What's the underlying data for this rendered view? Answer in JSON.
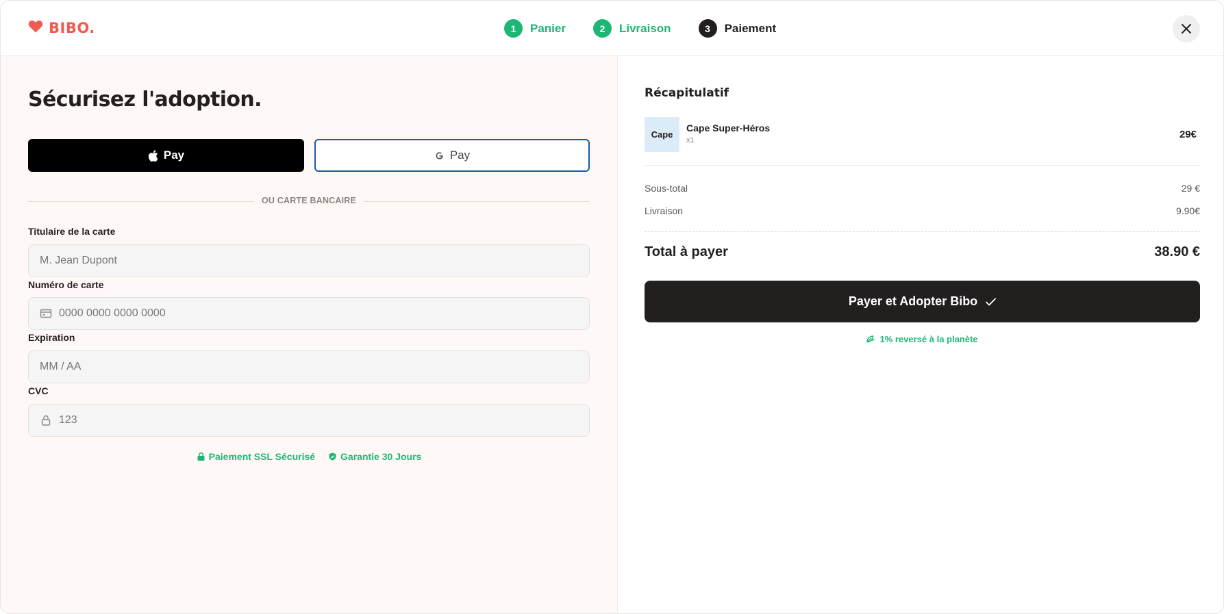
{
  "colors": {
    "brand": "#ef5a52",
    "success": "#1db674",
    "dark": "#231f1f",
    "left_panel_bg": "#fff8f6",
    "google_border": "#1a56a8"
  },
  "header": {
    "logo_icon": "heart-icon",
    "logo_text": "BIBO.",
    "steps": [
      {
        "number": "1",
        "label": "Panier",
        "state": "done"
      },
      {
        "number": "2",
        "label": "Livraison",
        "state": "done"
      },
      {
        "number": "3",
        "label": "Paiement",
        "state": "active"
      }
    ],
    "close_icon": "close-icon"
  },
  "payment": {
    "title": "Sécurisez l'adoption.",
    "apple_pay_label": "Pay",
    "google_pay_label": "Pay",
    "divider_text": "OU CARTE BANCAIRE",
    "fields": {
      "holder": {
        "label": "Titulaire de la carte",
        "placeholder": "M. Jean Dupont",
        "value": ""
      },
      "number": {
        "label": "Numéro de carte",
        "placeholder": "0000 0000 0000 0000",
        "value": "",
        "icon": "credit-card-icon"
      },
      "expiry": {
        "label": "Expiration",
        "placeholder": "MM / AA",
        "value": ""
      },
      "cvc": {
        "label": "CVC",
        "placeholder": "123",
        "value": "",
        "icon": "lock-icon"
      }
    },
    "trust": {
      "ssl": "Paiement SSL Sécurisé",
      "guarantee": "Garantie 30 Jours"
    }
  },
  "summary": {
    "title": "Récapitulatif",
    "item": {
      "thumb_text": "Cape",
      "name": "Cape Super-Héros",
      "quantity": "x1",
      "price": "29€"
    },
    "subtotal_label": "Sous-total",
    "subtotal_value": "29 €",
    "shipping_label": "Livraison",
    "shipping_value": "9.90€",
    "total_label": "Total à payer",
    "total_value": "38.90 €",
    "pay_button": "Payer et Adopter Bibo",
    "eco_note": "1% reversé à la planète"
  }
}
